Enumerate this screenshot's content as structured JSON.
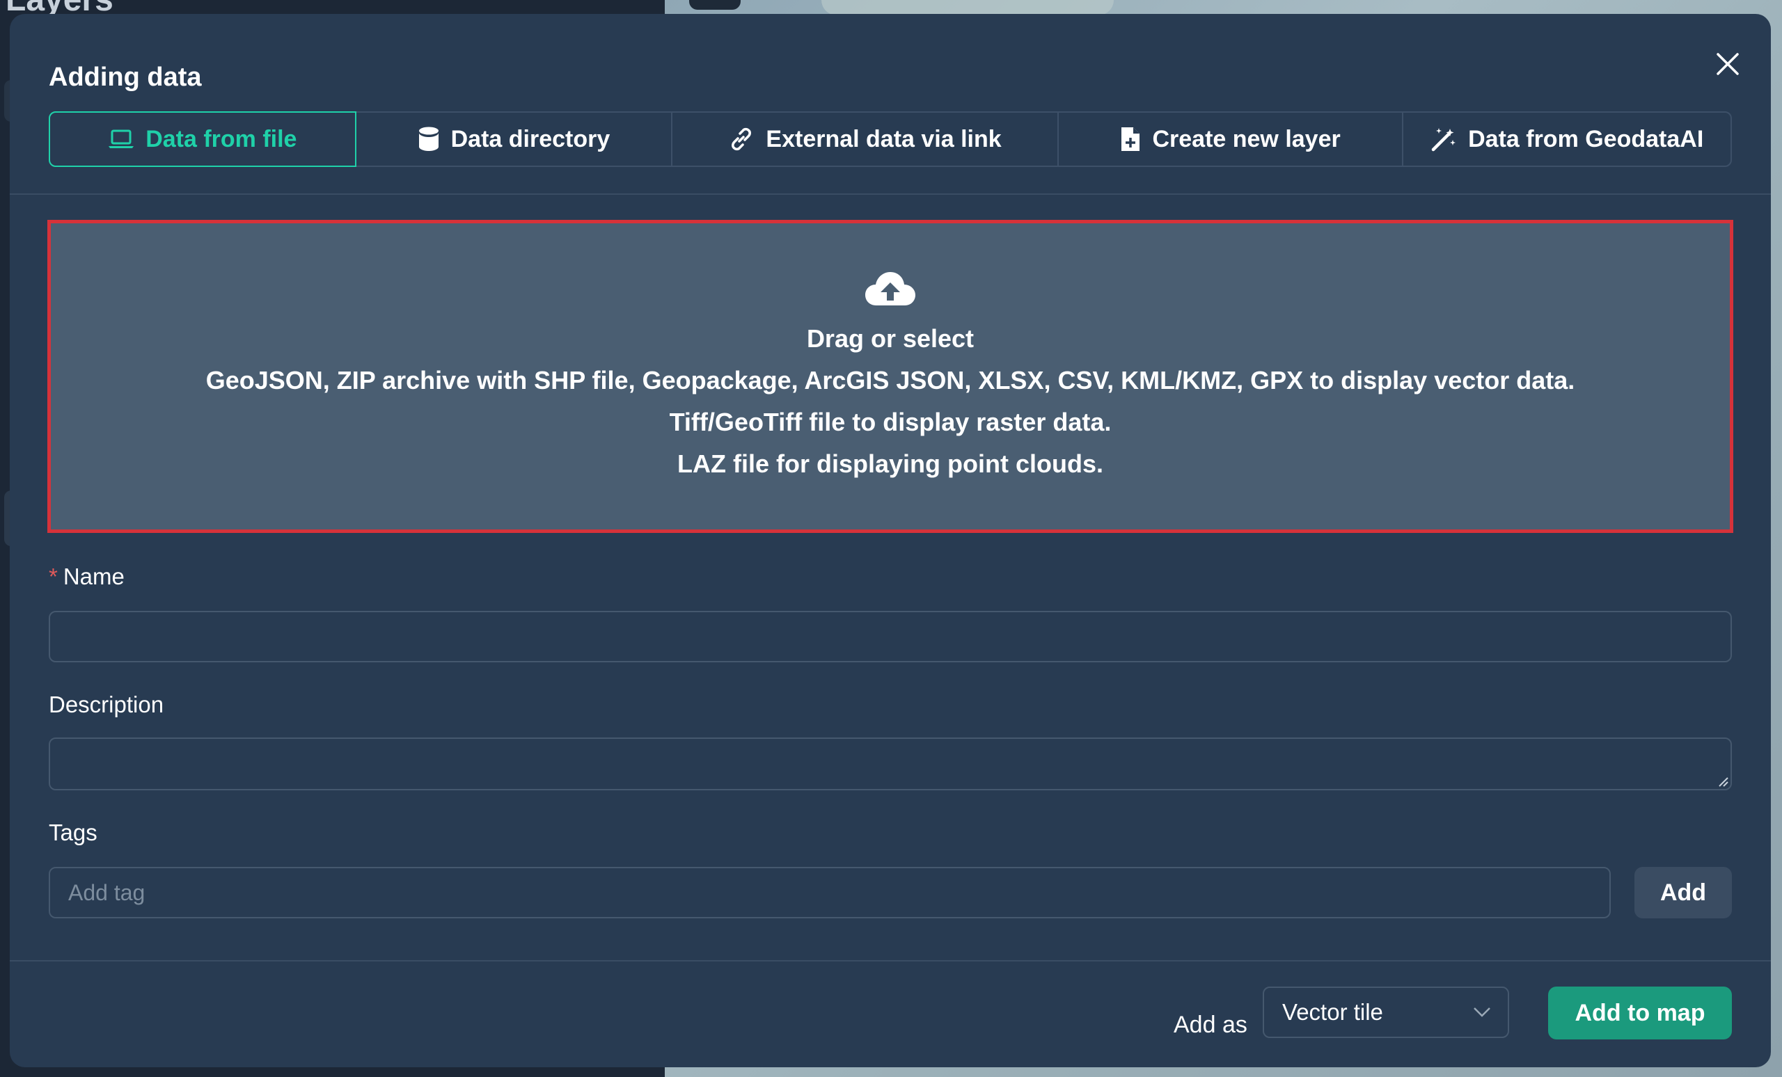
{
  "background": {
    "title": "Layers"
  },
  "modal": {
    "title": "Adding data",
    "tabs": [
      {
        "label": "Data from file",
        "icon": "laptop-icon",
        "active": true
      },
      {
        "label": "Data directory",
        "icon": "database-icon",
        "active": false
      },
      {
        "label": "External data via link",
        "icon": "link-icon",
        "active": false
      },
      {
        "label": "Create new layer",
        "icon": "file-plus-icon",
        "active": false
      },
      {
        "label": "Data from GeodataAI",
        "icon": "magic-wand-icon",
        "active": false
      }
    ],
    "dropzone": {
      "icon": "cloud-upload-icon",
      "heading": "Drag or select",
      "lines": [
        "GeoJSON, ZIP archive with SHP file, Geopackage, ArcGIS JSON, XLSX, CSV, KML/KMZ, GPX to display vector data.",
        "Tiff/GeoTiff file to display raster data.",
        "LAZ file for displaying point clouds."
      ]
    },
    "form": {
      "name_label": "Name",
      "name_required_mark": "*",
      "name_value": "",
      "description_label": "Description",
      "description_value": "",
      "tags_label": "Tags",
      "tags_placeholder": "Add tag",
      "add_tag_button": "Add"
    },
    "footer": {
      "add_as_label": "Add as",
      "add_as_value": "Vector tile",
      "submit_button": "Add to map"
    }
  },
  "colors": {
    "accent": "#1fd1a9",
    "primary_button": "#1b9a7d",
    "modal_bg": "#283b52",
    "dropzone_bg": "#4a5e72",
    "dropzone_border": "#d6323a"
  }
}
